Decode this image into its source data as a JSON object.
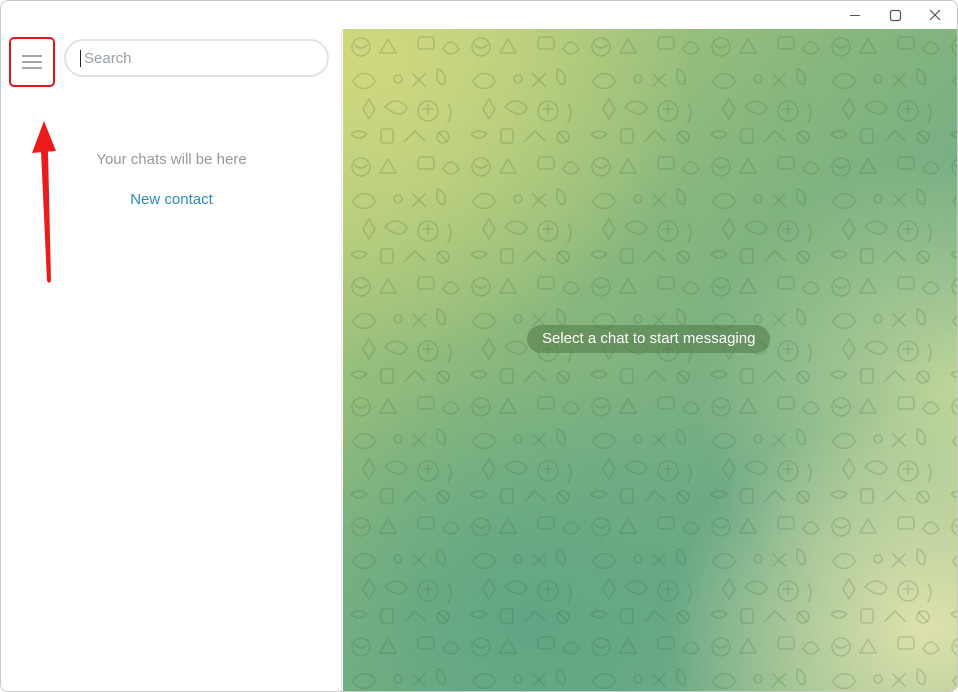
{
  "window": {
    "controls": {
      "minimize_icon": "minimize-icon",
      "maximize_icon": "maximize-icon",
      "close_icon": "close-icon"
    }
  },
  "sidebar": {
    "menu_icon": "hamburger-menu-icon",
    "search": {
      "placeholder": "Search",
      "value": ""
    },
    "empty_state": {
      "message": "Your chats will be here",
      "link": "New contact"
    },
    "annotation_color": "#e8141c"
  },
  "chat": {
    "placeholder": "Select a chat to start messaging"
  },
  "colors": {
    "link": "#2a8bb8",
    "highlight": "#e8141c",
    "muted_text": "#999999"
  }
}
